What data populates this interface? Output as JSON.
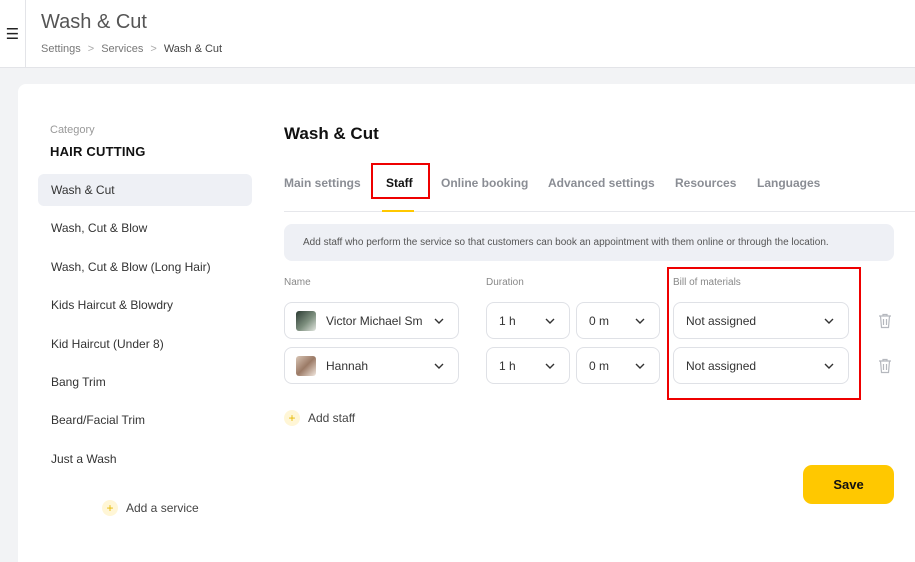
{
  "header": {
    "menu_icon": "hamburger-icon",
    "title": "Wash & Cut",
    "breadcrumb": [
      {
        "label": "Settings"
      },
      {
        "label": "Services"
      },
      {
        "label": "Wash & Cut"
      }
    ],
    "breadcrumb_sep": ">"
  },
  "sidebar": {
    "category_label": "Category",
    "category_name": "HAIR CUTTING",
    "services": [
      {
        "label": "Wash & Cut",
        "active": true
      },
      {
        "label": "Wash, Cut & Blow"
      },
      {
        "label": "Wash, Cut & Blow (Long Hair)"
      },
      {
        "label": "Kids Haircut & Blowdry"
      },
      {
        "label": "Kid Haircut (Under 8)"
      },
      {
        "label": "Bang Trim"
      },
      {
        "label": "Beard/Facial Trim"
      },
      {
        "label": "Just a Wash"
      }
    ],
    "add_service_label": "Add a service"
  },
  "main": {
    "title": "Wash & Cut",
    "tabs": [
      {
        "label": "Main settings"
      },
      {
        "label": "Staff",
        "active": true
      },
      {
        "label": "Online booking"
      },
      {
        "label": "Advanced settings"
      },
      {
        "label": "Resources"
      },
      {
        "label": "Languages"
      }
    ],
    "info_text": "Add staff who perform the service so that customers can book an appointment with them online or through the location.",
    "columns": {
      "name": "Name",
      "duration": "Duration",
      "bom": "Bill of materials"
    },
    "staff": [
      {
        "name": "Victor Michael Sm",
        "hours": "1 h",
        "minutes": "0 m",
        "bom": "Not assigned"
      },
      {
        "name": "Hannah",
        "hours": "1 h",
        "minutes": "0 m",
        "bom": "Not assigned"
      }
    ],
    "add_staff_label": "Add staff",
    "save_label": "Save",
    "plus_glyph": "+"
  },
  "colors": {
    "accent": "#ffc800",
    "highlight_box": "#e00000"
  }
}
